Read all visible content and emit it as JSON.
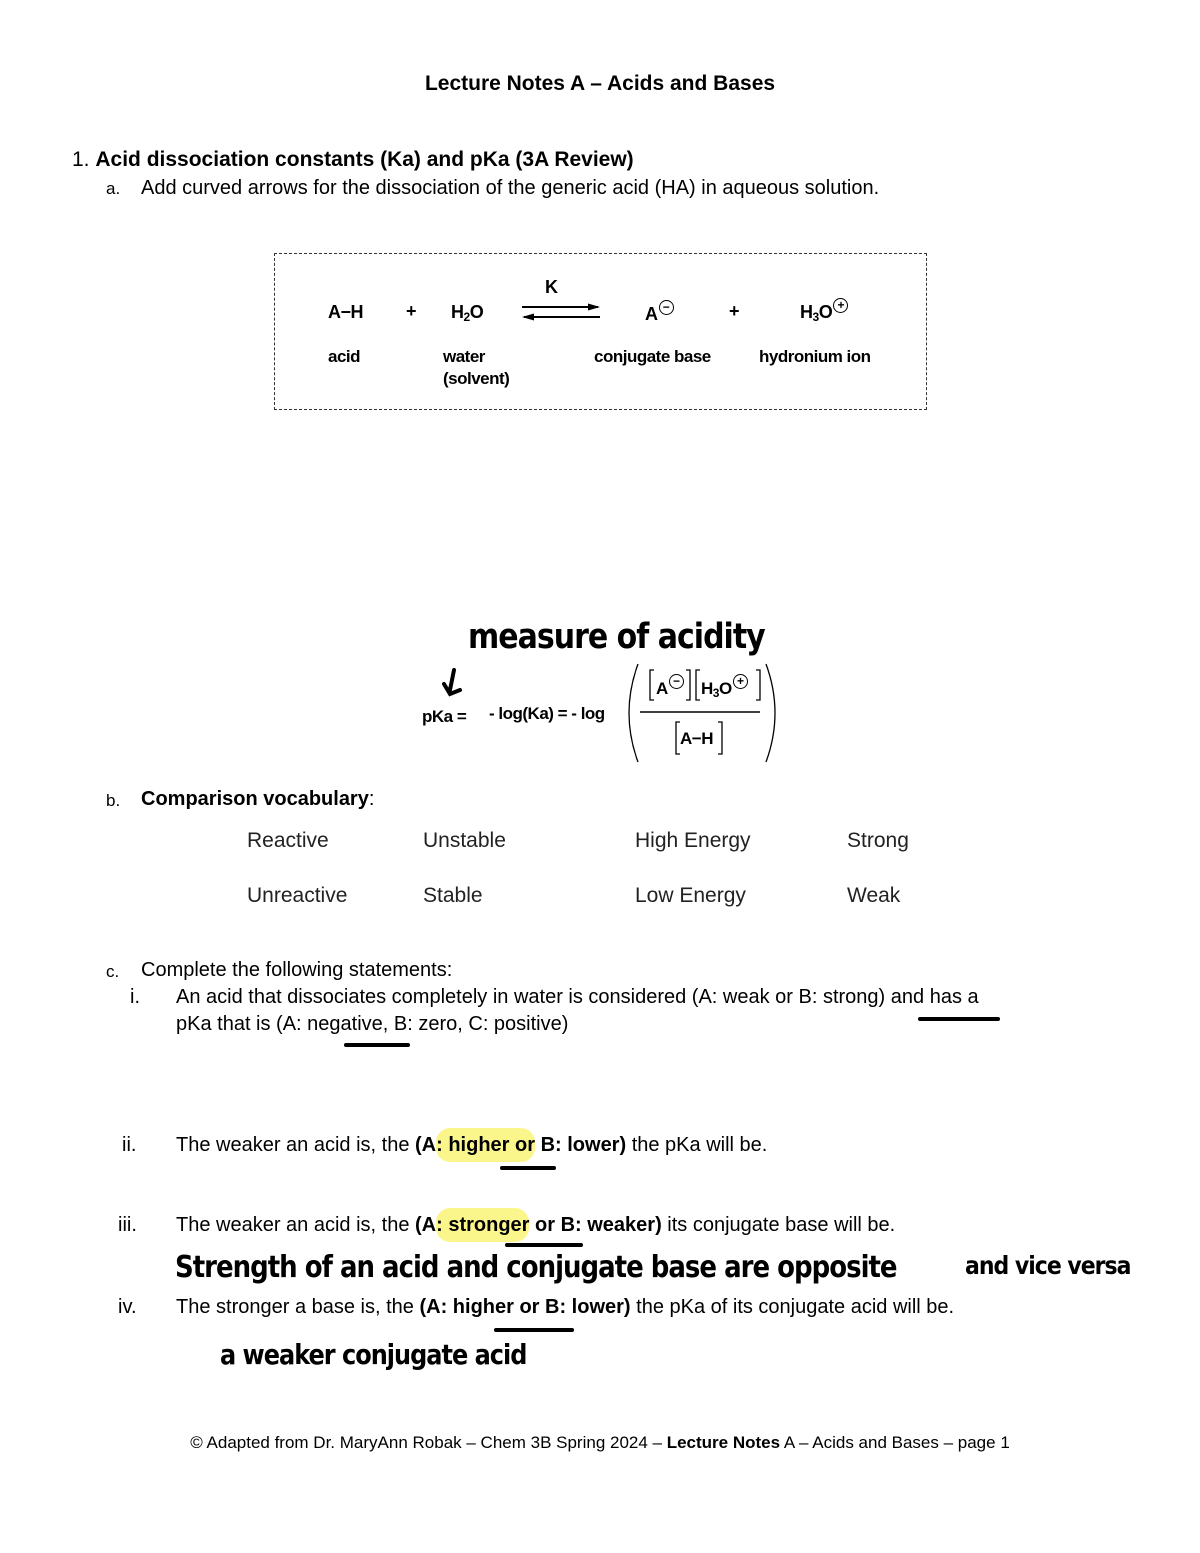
{
  "title": "Lecture Notes A – Acids and Bases",
  "section1": {
    "number": "1.",
    "heading": "Acid dissociation constants (Ka) and pKa (3A Review)"
  },
  "item_a": {
    "marker": "a.",
    "text": "Add curved arrows for the dissociation of the generic acid (HA) in aqueous solution."
  },
  "reaction": {
    "reactant1": "A−H",
    "plus1": "+",
    "reactant2_main": "H",
    "reactant2_sub": "2",
    "reactant2_end": "O",
    "equilibrium_label": "K",
    "product1": "A",
    "product1_charge": "−",
    "plus2": "+",
    "product2_main": "H",
    "product2_sub": "3",
    "product2_end": "O",
    "product2_charge": "+",
    "labels": {
      "acid": "acid",
      "water_line1": "water",
      "water_line2": "(solvent)",
      "conjugate_base": "conjugate base",
      "hydronium": "hydronium ion"
    }
  },
  "equation": {
    "handwritten_note": "measure of acidity",
    "lhs": "pKa =",
    "mid": "- log(Ka) = - log",
    "numerator_a": "A",
    "numerator_a_charge": "−",
    "numerator_h": "H",
    "numerator_sub": "3",
    "numerator_o": "O",
    "numerator_charge": "+",
    "denominator": "A−H"
  },
  "item_b": {
    "marker": "b.",
    "label": "Comparison vocabulary",
    "colon": ":",
    "rows": [
      [
        "Reactive",
        "Unstable",
        "High Energy",
        "Strong"
      ],
      [
        "Unreactive",
        "Stable",
        "Low Energy",
        "Weak"
      ]
    ]
  },
  "item_c": {
    "marker": "c.",
    "text": "Complete the following statements:",
    "statements": [
      {
        "marker": "i.",
        "line1": "An acid that dissociates completely in water is considered (A: weak or B: strong) and has a",
        "line2": "pKa that is (A: negative, B: zero, C: positive)"
      },
      {
        "marker": "ii.",
        "pre": "The weaker an acid is, the ",
        "bold_open": "(A",
        "bold_hl": ": higher or",
        "bold_close": " B: lower)",
        "post": " the pKa will be."
      },
      {
        "marker": "iii.",
        "pre": "The weaker an acid is, the ",
        "bold_open": "(A",
        "bold_hl": ": stronger",
        "bold_close": " or B: weaker)",
        "post": " its conjugate base will be.",
        "handwritten_note": "Strength of an acid and conjugate base are opposite",
        "handwritten_note2": "and vice versa"
      },
      {
        "marker": "iv.",
        "pre": "The stronger a base is, the ",
        "bold": "(A: higher or B: lower)",
        "post": " the pKa of its conjugate acid will be.",
        "handwritten_note": "a weaker conjugate acid"
      }
    ]
  },
  "footer": {
    "pre": "© Adapted from Dr. MaryAnn Robak – Chem 3B Spring 2024 – ",
    "bold": "Lecture Notes",
    "post": " A – Acids and Bases – page 1"
  }
}
